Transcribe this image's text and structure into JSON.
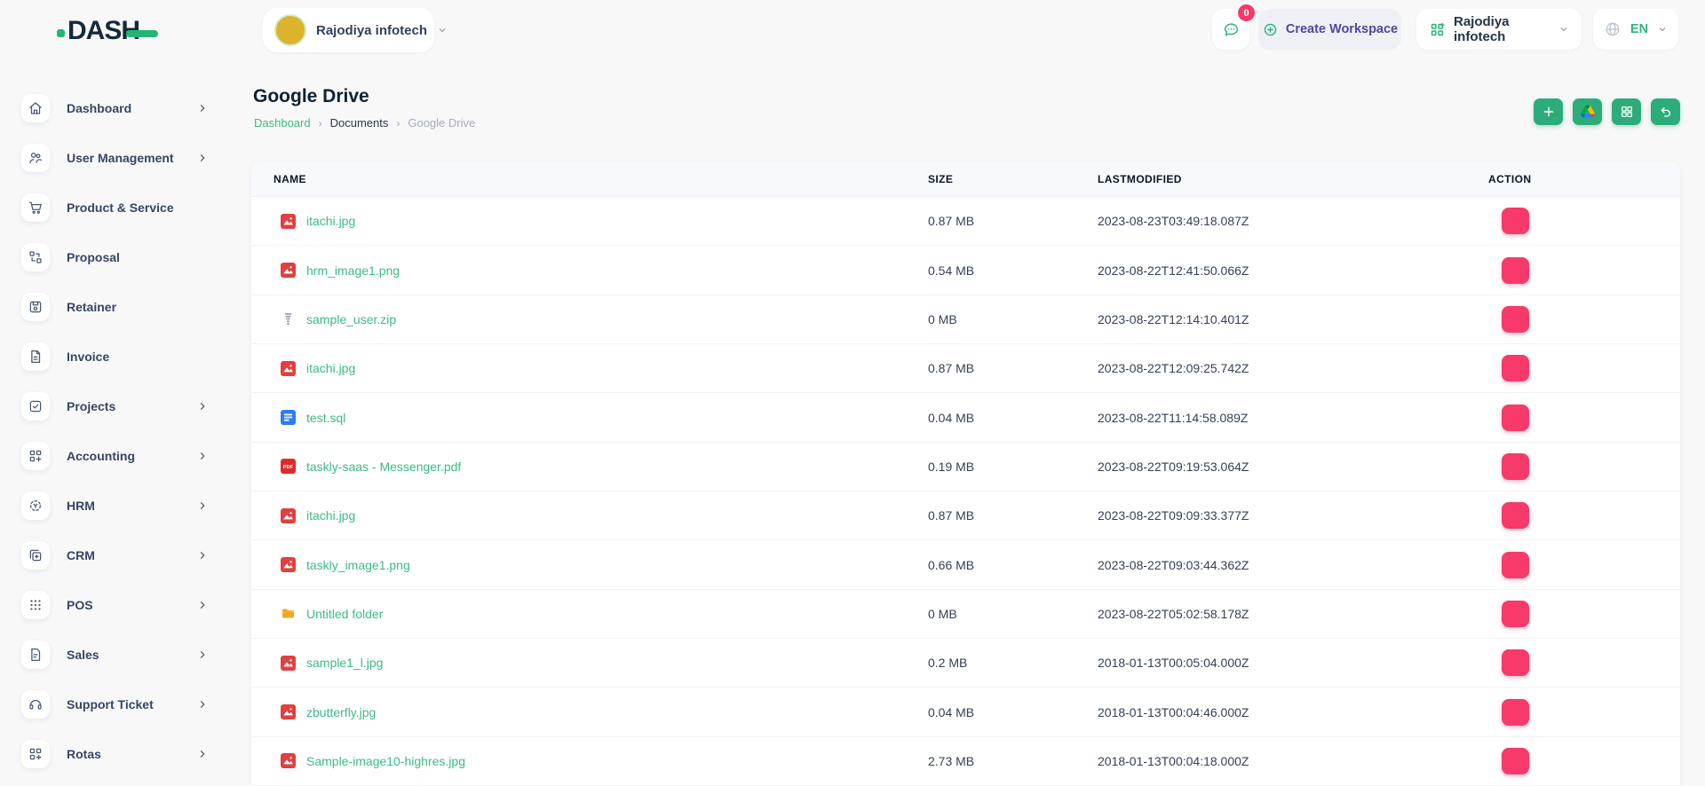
{
  "topbar": {
    "logo_text": "DASH",
    "workspace_switcher": {
      "label": "Rajodiya infotech"
    },
    "messages": {
      "badge_count": "0"
    },
    "create_workspace": {
      "label": "Create Workspace"
    },
    "company_menu": {
      "label": "Rajodiya infotech"
    },
    "language_menu": {
      "label": "EN"
    }
  },
  "sidebar": {
    "items": [
      {
        "label": "Dashboard",
        "icon": "home-icon",
        "has_submenu": true
      },
      {
        "label": "User Management",
        "icon": "users-icon",
        "has_submenu": true
      },
      {
        "label": "Product & Service",
        "icon": "cart-icon",
        "has_submenu": false
      },
      {
        "label": "Proposal",
        "icon": "transfer-icon",
        "has_submenu": false
      },
      {
        "label": "Retainer",
        "icon": "save-icon",
        "has_submenu": false
      },
      {
        "label": "Invoice",
        "icon": "invoice-icon",
        "has_submenu": false
      },
      {
        "label": "Projects",
        "icon": "check-square-icon",
        "has_submenu": true
      },
      {
        "label": "Accounting",
        "icon": "grid-plus-icon",
        "has_submenu": true
      },
      {
        "label": "HRM",
        "icon": "target-icon",
        "has_submenu": true
      },
      {
        "label": "CRM",
        "icon": "copy-plus-icon",
        "has_submenu": true
      },
      {
        "label": "POS",
        "icon": "grid-dots-icon",
        "has_submenu": true
      },
      {
        "label": "Sales",
        "icon": "file-text-icon",
        "has_submenu": true
      },
      {
        "label": "Support Ticket",
        "icon": "headset-icon",
        "has_submenu": true
      },
      {
        "label": "Rotas",
        "icon": "grid-plus-icon",
        "has_submenu": true
      }
    ]
  },
  "page": {
    "title": "Google Drive",
    "breadcrumb": [
      {
        "label": "Dashboard",
        "style": "link"
      },
      {
        "label": "Documents",
        "style": "mid"
      },
      {
        "label": "Google Drive",
        "style": "current"
      }
    ]
  },
  "toolbar": {
    "buttons": [
      {
        "icon": "plus-icon"
      },
      {
        "icon": "google-drive-icon"
      },
      {
        "icon": "grid-icon"
      },
      {
        "icon": "undo-icon"
      }
    ]
  },
  "table": {
    "columns": [
      "NAME",
      "SIZE",
      "LASTMODIFIED",
      "ACTION"
    ],
    "rows": [
      {
        "name": "itachi.jpg",
        "type": "image",
        "size": "0.87 MB",
        "modified": "2023-08-23T03:49:18.087Z"
      },
      {
        "name": "hrm_image1.png",
        "type": "image",
        "size": "0.54 MB",
        "modified": "2023-08-22T12:41:50.066Z"
      },
      {
        "name": "sample_user.zip",
        "type": "zip",
        "size": "0 MB",
        "modified": "2023-08-22T12:14:10.401Z"
      },
      {
        "name": "itachi.jpg",
        "type": "image",
        "size": "0.87 MB",
        "modified": "2023-08-22T12:09:25.742Z"
      },
      {
        "name": "test.sql",
        "type": "sql",
        "size": "0.04 MB",
        "modified": "2023-08-22T11:14:58.089Z"
      },
      {
        "name": "taskly-saas - Messenger.pdf",
        "type": "pdf",
        "size": "0.19 MB",
        "modified": "2023-08-22T09:19:53.064Z"
      },
      {
        "name": "itachi.jpg",
        "type": "image",
        "size": "0.87 MB",
        "modified": "2023-08-22T09:09:33.377Z"
      },
      {
        "name": "taskly_image1.png",
        "type": "image",
        "size": "0.66 MB",
        "modified": "2023-08-22T09:03:44.362Z"
      },
      {
        "name": "Untitled folder",
        "type": "folder",
        "size": "0 MB",
        "modified": "2023-08-22T05:02:58.178Z"
      },
      {
        "name": "sample1_l.jpg",
        "type": "image",
        "size": "0.2 MB",
        "modified": "2018-01-13T00:05:04.000Z"
      },
      {
        "name": "zbutterfly.jpg",
        "type": "image",
        "size": "0.04 MB",
        "modified": "2018-01-13T00:04:46.000Z"
      },
      {
        "name": "Sample-image10-highres.jpg",
        "type": "image",
        "size": "2.73 MB",
        "modified": "2018-01-13T00:04:18.000Z"
      }
    ]
  },
  "colors": {
    "accent_green": "#2dac7b",
    "link_green": "#3cba85",
    "danger_pink": "#f73a69",
    "brand_purple": "#51459e",
    "text_dark": "#142a3d"
  }
}
